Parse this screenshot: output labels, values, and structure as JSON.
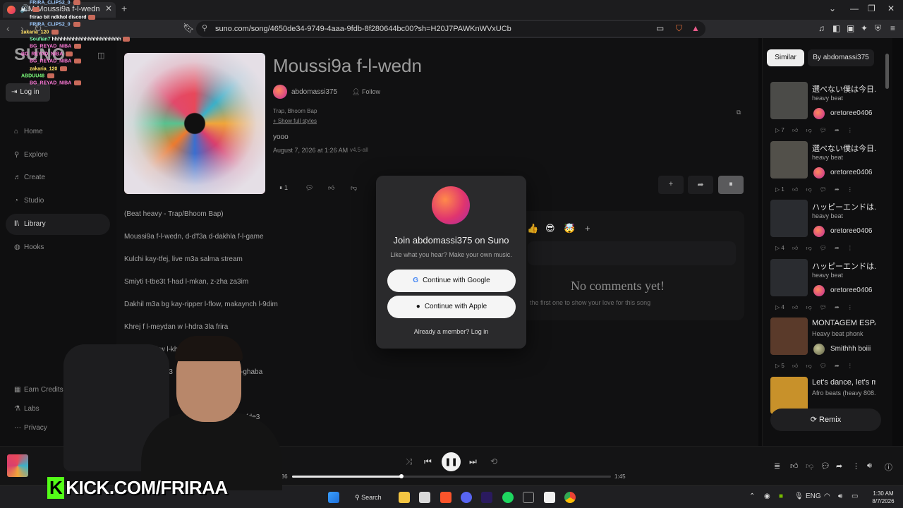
{
  "browser": {
    "tab_title": "M Moussi9a f-l-wedn",
    "url": "suno.com/song/4650de34-9749-4aaa-9fdb-8f280644bc00?sh=H20J7PAWKnWVxUCb"
  },
  "chat": [
    {
      "user": "FRIRA_CLIPS2_0",
      "msg": "",
      "color": "#9ecbff"
    },
    {
      "user": "M...",
      "msg": "",
      "color": "#ffffff"
    },
    {
      "user": "",
      "msg": "frirao bit ndkhol discord",
      "color": "#ffffff"
    },
    {
      "user": "FRIRA_CLIPS2_0",
      "msg": "",
      "color": "#9ecbff"
    },
    {
      "user": "zakaria_120",
      "msg": "",
      "color": "#ffe066"
    },
    {
      "user": "Soufian7",
      "msg": "hhhhhhhhhhhhhhhhhhhhhhh",
      "color": "#7fffb0"
    },
    {
      "user": "BG_REYAD_NIBA",
      "msg": "",
      "color": "#ff7ad9"
    },
    {
      "user": "BG_REYAD_NIBA",
      "msg": "",
      "color": "#ff7ad9"
    },
    {
      "user": "BG_REYAD_NIBA",
      "msg": "",
      "color": "#ff7ad9"
    },
    {
      "user": "zakaria_120",
      "msg": "",
      "color": "#ffe066"
    },
    {
      "user": "ABDUU48",
      "msg": "",
      "color": "#7dff7d"
    },
    {
      "user": "BG_REYAD_NIBA",
      "msg": "",
      "color": "#ff7ad9"
    }
  ],
  "sidebar": {
    "logo": "SUNO",
    "login_label": "Log in",
    "nav": [
      {
        "label": "Home",
        "icon": "home-icon"
      },
      {
        "label": "Explore",
        "icon": "search-icon"
      },
      {
        "label": "Create",
        "icon": "music-note-icon"
      },
      {
        "label": "Studio",
        "icon": "studio-icon"
      },
      {
        "label": "Library",
        "icon": "library-icon",
        "active": true
      },
      {
        "label": "Hooks",
        "icon": "hooks-icon"
      }
    ],
    "footer": [
      {
        "label": "Earn Credits"
      },
      {
        "label": "Labs"
      },
      {
        "label": "Privacy"
      }
    ]
  },
  "song": {
    "title": "Moussi9a f-l-wedn",
    "artist": "abdomassi375",
    "follow_label": "Follow",
    "genre": "Trap, Bhoom Bap",
    "show_styles": "+ Show full styles",
    "description": "yooo",
    "date": "August 7, 2026 at 1:26 AM",
    "version": "v4.5-all",
    "play_count": "1"
  },
  "lyrics": [
    "(Beat heavy - Trap/Bhoom Bap)",
    "Moussi9a f-l-wedn, d-d'f3a d-dakhla f-l-game",
    "Kulchi kay-tfej, live m3a salma stream",
    "Smiyti t-tbe3t f-had l-mkan, z-zha za3im",
    "Dakhil m3a bg kay-ripper l-flow, makaynch l-9dim",
    "Khrej f l-meydan w l-hdra 3la frira",
    "3ali w l-khatar",
    "m3",
    "-ghaba",
    "kay-fde3",
    "3"
  ],
  "comments": {
    "reactions": [
      "👍",
      "😎",
      "🤯"
    ],
    "empty_title": "No comments yet!",
    "empty_sub": "the first one to show your love for this song"
  },
  "right_panel": {
    "tabs": [
      "Similar",
      "By abdomassi375"
    ],
    "items": [
      {
        "title": "選べない僕は今日...",
        "sub": "heavy beat",
        "user": "oretoree0406",
        "plays": "7",
        "thumb": "#4b4b48"
      },
      {
        "title": "選べない僕は今日...",
        "sub": "heavy beat",
        "user": "oretoree0406",
        "plays": "1",
        "thumb": "#52504a"
      },
      {
        "title": "ハッピーエンドは...",
        "sub": "heavy beat",
        "user": "oretoree0406",
        "plays": "4",
        "thumb": "#2a2c30"
      },
      {
        "title": "ハッピーエンドは...",
        "sub": "heavy beat",
        "user": "oretoree0406",
        "plays": "4",
        "thumb": "#2a2c30"
      },
      {
        "title": "MONTAGEM ESPA...",
        "sub": "Heavy beat phonk",
        "user": "Smithhh boiii",
        "plays": "5",
        "thumb": "#5a3a2a"
      },
      {
        "title": "Let's dance, let's m...",
        "sub": "Afro beats (heavy 808...",
        "user": "",
        "plays": "",
        "thumb": "#c8912a"
      }
    ],
    "remix_label": "Remix"
  },
  "modal": {
    "title": "Join abdomassi375 on Suno",
    "subtitle": "Like what you hear? Make your own music.",
    "google_label": "Continue with Google",
    "apple_label": "Continue with Apple",
    "login_label": "Already a member? Log in"
  },
  "player": {
    "elapsed": "0:36",
    "duration": "1:45",
    "progress": 0.343
  },
  "overlay": {
    "kick_text": "KICK.COM/FRIRAA"
  },
  "taskbar": {
    "search_label": "Search",
    "lang": "ENG",
    "time": "1:30 AM",
    "date": "8/7/2026"
  }
}
